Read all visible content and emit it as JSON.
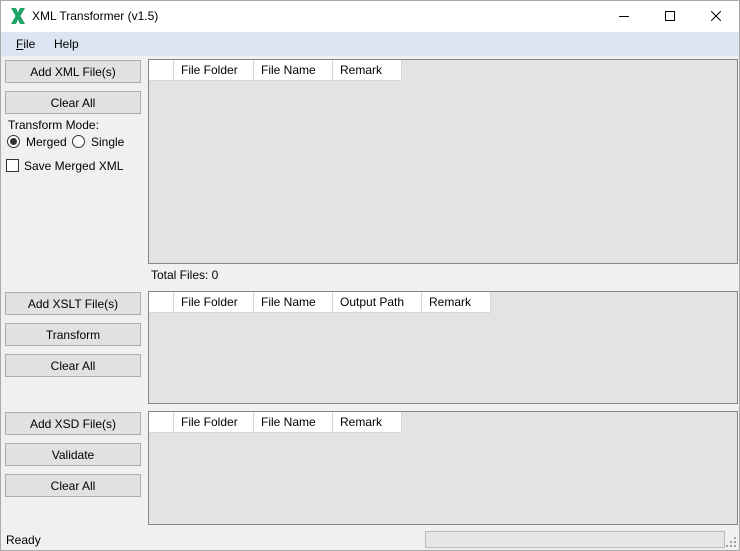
{
  "window": {
    "title": "XML Transformer (v1.5)"
  },
  "menu": {
    "file_first": "F",
    "file_rest": "ile",
    "help": "Help"
  },
  "xml_section": {
    "add_button": "Add XML File(s)",
    "clear_button": "Clear All",
    "transform_mode_label": "Transform Mode:",
    "mode_options": [
      "Merged",
      "Single"
    ],
    "selected_mode": "Merged",
    "save_merged_label": "Save Merged XML",
    "save_merged_checked": false,
    "columns": [
      "",
      "File Folder",
      "File Name",
      "Remark"
    ],
    "total_files": "Total Files: 0"
  },
  "xslt_section": {
    "add_button": "Add XSLT File(s)",
    "transform_button": "Transform",
    "clear_button": "Clear All",
    "columns": [
      "",
      "File Folder",
      "File Name",
      "Output Path",
      "Remark"
    ]
  },
  "xsd_section": {
    "add_button": "Add XSD File(s)",
    "validate_button": "Validate",
    "clear_button": "Clear All",
    "columns": [
      "",
      "File Folder",
      "File Name",
      "Remark"
    ]
  },
  "status": {
    "text": "Ready",
    "progress": 0
  },
  "colors": {
    "menu_bg": "#dce6f3",
    "grid_bg": "#e3e3e3",
    "icon_green": "#21a366"
  },
  "icons": [
    "app-x-icon",
    "minimize-icon",
    "maximize-icon",
    "close-icon",
    "size-grip-icon"
  ]
}
